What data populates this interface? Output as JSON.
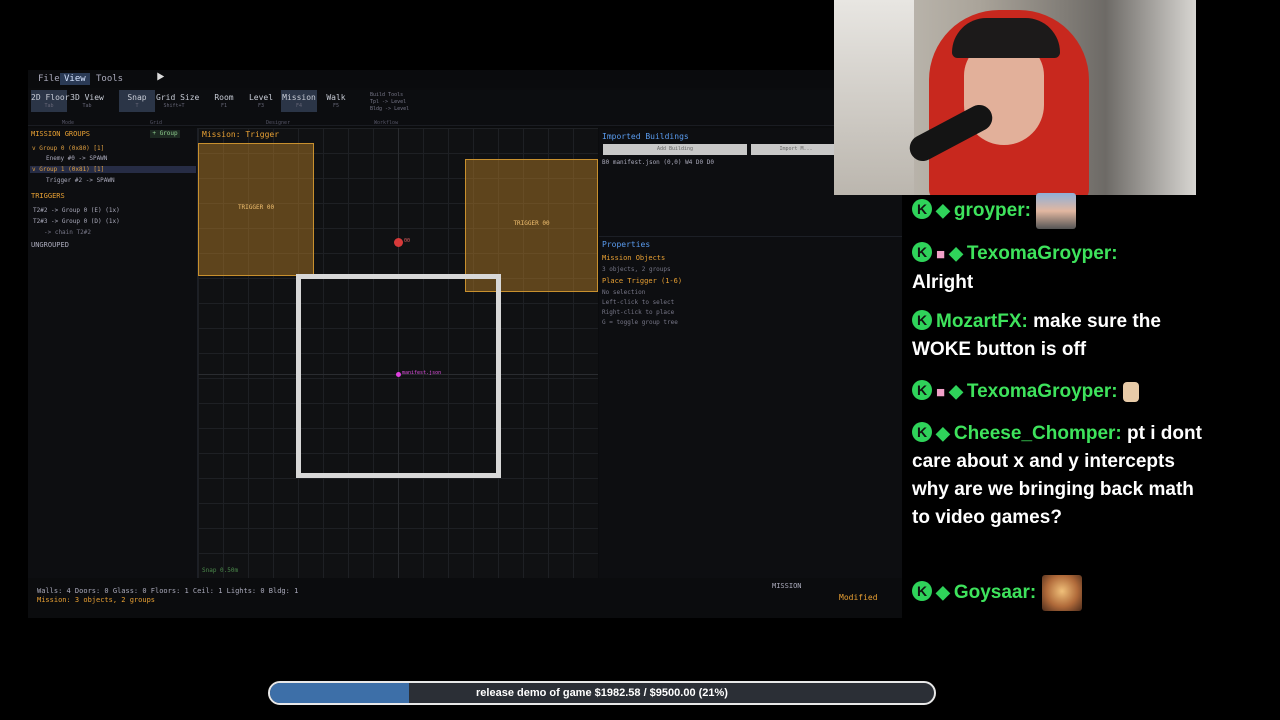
{
  "menu": {
    "items": [
      "File",
      "View",
      "Tools"
    ],
    "active": "View"
  },
  "toolbar": {
    "mode_buttons": [
      {
        "label": "2D Floor",
        "hint": "Tab"
      },
      {
        "label": "3D View",
        "hint": "Tab"
      }
    ],
    "grid_buttons": [
      {
        "label": "Snap",
        "hint": "T"
      },
      {
        "label": "Grid Size",
        "hint": "Shift+T"
      }
    ],
    "designer_buttons": [
      {
        "label": "Room",
        "hint": "F1"
      },
      {
        "label": "Level",
        "hint": "F3"
      },
      {
        "label": "Mission",
        "hint": "F4"
      },
      {
        "label": "Walk",
        "hint": "F5"
      }
    ],
    "group_labels": {
      "mode": "Mode",
      "grid": "Grid",
      "designer": "Designer",
      "workflow": "Workflow"
    },
    "build_tools": [
      "Build Tools",
      "Tpl -> Level",
      "Bldg -> Level"
    ]
  },
  "left_panel": {
    "mission_groups_title": "MISSION GROUPS",
    "add_group_label": "+ Group",
    "groups": [
      {
        "label": "v Group 0 (0x80) [1]",
        "child": "Enemy #0 -> SPAWN"
      },
      {
        "label": "v Group 1 (0x81) [1]",
        "child": "Trigger #2 -> SPAWN"
      }
    ],
    "triggers_title": "TRIGGERS",
    "triggers": [
      "T2#2 -> Group 0 (E) (1x)",
      "T2#3 -> Group 0 (D) (1x)",
      "-> chain T2#2"
    ],
    "ungrouped_title": "UNGROUPED"
  },
  "viewport": {
    "title": "Mission: Trigger",
    "triggers": [
      "TRIGGER 00",
      "TRIGGER 00"
    ],
    "spawn_label": "00",
    "origin_label": "manifest.json",
    "snap_label": "Snap 0.50m"
  },
  "right_panel": {
    "imported_title": "Imported Buildings",
    "add_building_label": "Add Building",
    "import_label": "Import M...",
    "imported_item": "B0 manifest.json (0,0) W4 D0 D0",
    "properties_title": "Properties",
    "mission_objects_title": "Mission Objects",
    "lines": [
      "3 objects, 2 groups",
      "Place Trigger (1-6)",
      "No selection",
      "Left-click to select",
      "Right-click to place",
      "G = toggle group tree"
    ]
  },
  "statusbar": {
    "line1": "Walls: 4  Doors: 0  Glass: 0  Floors: 1  Ceil: 1  Lights: 0  Bldg: 1",
    "line2": "Mission: 3 objects, 2 groups",
    "mode": "MISSION",
    "modified": "Modified"
  },
  "chat": [
    {
      "user": "groyper:",
      "text": "",
      "badges": [
        "k",
        "diamond"
      ],
      "emote": "face1"
    },
    {
      "user": "TexomaGroyper:",
      "text": "Alright",
      "badges": [
        "k",
        "gift",
        "diamond"
      ]
    },
    {
      "user": "MozartFX:",
      "text": "make sure the WOKE button is off",
      "badges": [
        "k"
      ]
    },
    {
      "user": "TexomaGroyper:",
      "text": "",
      "badges": [
        "k",
        "gift",
        "diamond"
      ],
      "emote": "hand"
    },
    {
      "user": "Cheese_Chomper:",
      "text": "pt i dont care about x and y intercepts why are we bringing back math to video games?",
      "badges": [
        "k",
        "diamond"
      ]
    },
    {
      "user": "Goysaar:",
      "text": "",
      "badges": [
        "k",
        "diamond"
      ],
      "emote": "face2"
    }
  ],
  "donation": {
    "text": "release demo of game $1982.58 / $9500.00 (21%)",
    "progress": 0.21,
    "fill_color": "#3d6fa8"
  }
}
